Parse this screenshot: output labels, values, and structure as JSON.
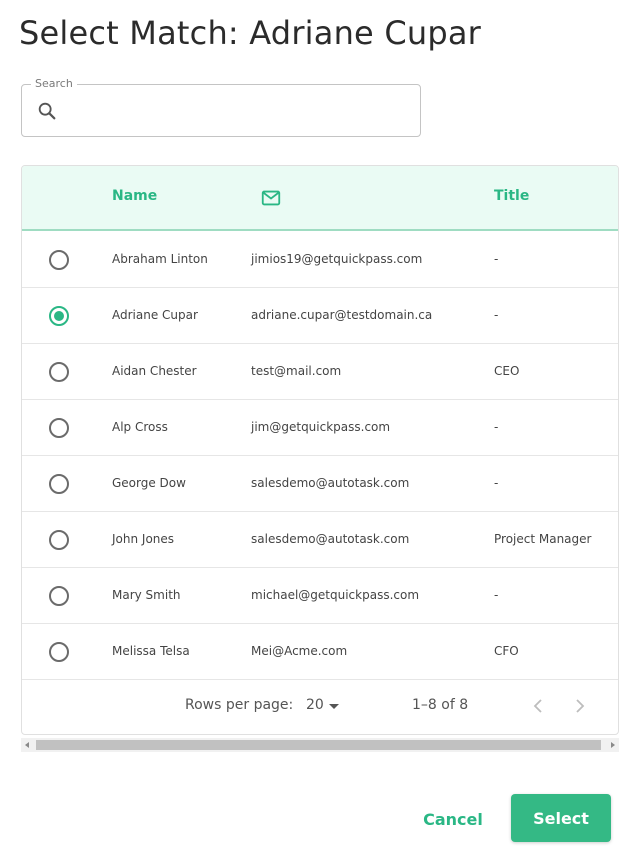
{
  "dialog": {
    "title": "Select Match: Adriane Cupar"
  },
  "search": {
    "label": "Search",
    "value": "",
    "placeholder": "",
    "icon": "search-icon"
  },
  "table": {
    "header": {
      "name": "Name",
      "email_icon": "mail-icon",
      "title": "Title"
    },
    "rows": [
      {
        "name": "Abraham Linton",
        "email": "jimios19@getquickpass.com",
        "title": "-",
        "selected": false
      },
      {
        "name": "Adriane Cupar",
        "email": "adriane.cupar@testdomain.ca",
        "title": "-",
        "selected": true
      },
      {
        "name": "Aidan Chester",
        "email": "test@mail.com",
        "title": "CEO",
        "selected": false
      },
      {
        "name": "Alp Cross",
        "email": "jim@getquickpass.com",
        "title": "-",
        "selected": false
      },
      {
        "name": "George Dow",
        "email": "salesdemo@autotask.com",
        "title": "-",
        "selected": false
      },
      {
        "name": "John Jones",
        "email": "salesdemo@autotask.com",
        "title": "Project Manager",
        "selected": false
      },
      {
        "name": "Mary Smith",
        "email": "michael@getquickpass.com",
        "title": "-",
        "selected": false
      },
      {
        "name": "Melissa Telsa",
        "email": "Mei@Acme.com",
        "title": "CFO",
        "selected": false
      }
    ]
  },
  "pagination": {
    "rows_per_page_label": "Rows per page:",
    "rows_per_page_value": "20",
    "range": "1–8 of 8"
  },
  "actions": {
    "cancel": "Cancel",
    "select": "Select"
  },
  "colors": {
    "accent": "#2ab785",
    "header_bg": "#eafbf4",
    "select_button": "#34b985"
  }
}
